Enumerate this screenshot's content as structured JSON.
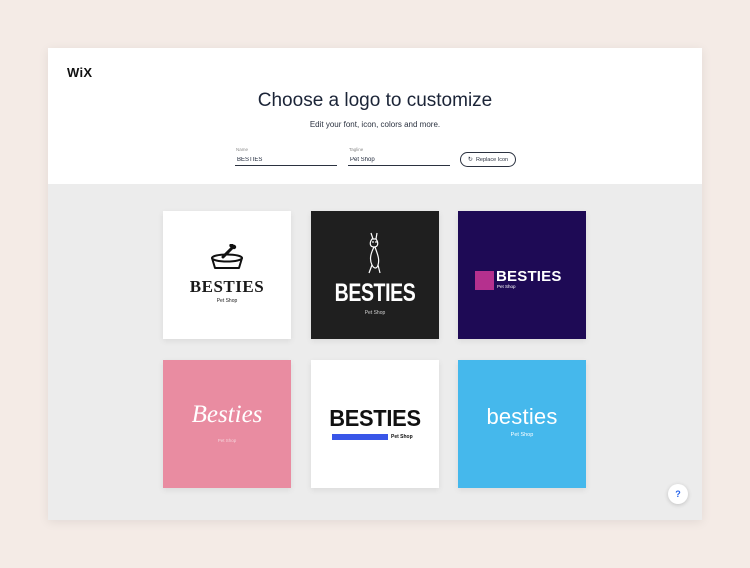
{
  "brand": {
    "name": "WiX"
  },
  "header": {
    "title": "Choose a logo to customize",
    "subtitle": "Edit your font, icon, colors and more."
  },
  "form": {
    "name": {
      "label": "Name",
      "value": "BESTIES"
    },
    "tagline": {
      "label": "Tagline",
      "value": "Pet Shop"
    },
    "replace_icon_label": "Replace Icon"
  },
  "logos": [
    {
      "name": "BESTIES",
      "tagline": "Pet Shop",
      "background": "#ffffff",
      "icon": "pet-bowl-icon"
    },
    {
      "name": "BESTIES",
      "tagline": "Pet Shop",
      "background": "#1f1f1f",
      "icon": "dog-illustration-icon"
    },
    {
      "name": "BESTIES",
      "tagline": "Pet Shop",
      "background": "#1e0a55",
      "accent": "#b5308e"
    },
    {
      "name": "Besties",
      "tagline": "Pet Shop",
      "background": "#e98ca1"
    },
    {
      "name": "BESTIES",
      "tagline": "Pet Shop",
      "background": "#ffffff",
      "accent": "#3956e8"
    },
    {
      "name": "besties",
      "tagline": "Pet Shop",
      "background": "#45b8ec"
    }
  ],
  "help": {
    "label": "?"
  }
}
